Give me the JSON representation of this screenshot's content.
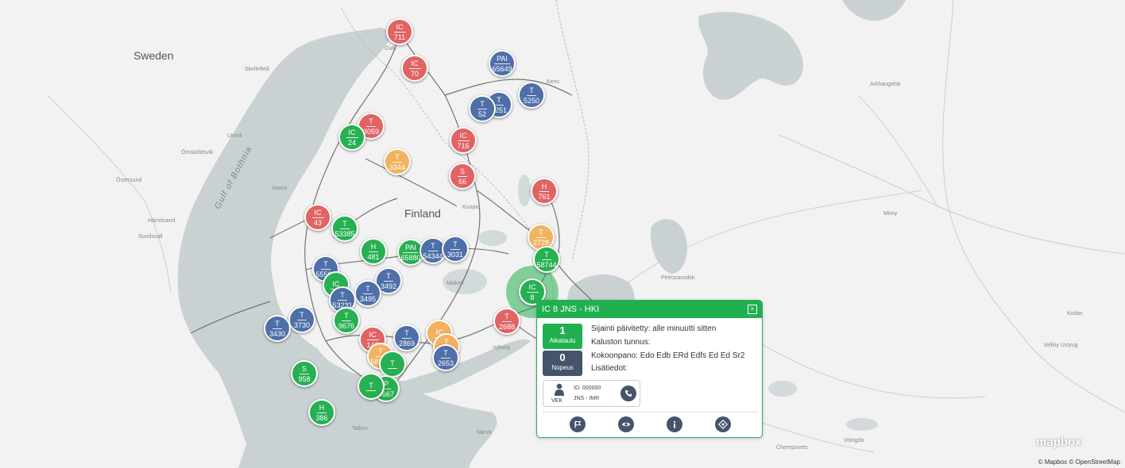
{
  "map": {
    "countries": [
      "Sweden",
      "Finland"
    ],
    "seas": [
      "Gulf of Bothnia"
    ],
    "cities": [
      "Oulu",
      "Skellefteå",
      "Umeå",
      "Örnsköldsvik",
      "Östersund",
      "Vaasa",
      "Härnösand",
      "Sundsvall",
      "Kuopio",
      "Mikkeli",
      "Vyborg",
      "Tallinn",
      "Narva",
      "Petrozavodsk",
      "Arkhangelsk",
      "Mirny",
      "Kotlas",
      "Velikiy Ustyug",
      "Vologda",
      "Cherepovets",
      "Kemi"
    ],
    "attribution": "© Mapbox © OpenStreetMap",
    "logo": "mapbox"
  },
  "colors": {
    "red": "#e16363",
    "green": "#27b052",
    "blue": "#4e6fa8",
    "orange": "#f3b260",
    "accent": "#20b04f",
    "button": "#45546a"
  },
  "markers": [
    {
      "type": "IC",
      "num": "711",
      "color": "red"
    },
    {
      "type": "IC",
      "num": "70",
      "color": "red"
    },
    {
      "type": "PAI",
      "num": "65649",
      "color": "blue"
    },
    {
      "type": "T",
      "num": "5250",
      "color": "blue"
    },
    {
      "type": "T",
      "num": "5251",
      "color": "blue"
    },
    {
      "type": "T",
      "num": "52",
      "color": "blue"
    },
    {
      "type": "T",
      "num": "3059",
      "color": "red"
    },
    {
      "type": "IC",
      "num": "24",
      "color": "green"
    },
    {
      "type": "IC",
      "num": "716",
      "color": "red"
    },
    {
      "type": "T",
      "num": "3344",
      "color": "orange"
    },
    {
      "type": "S",
      "num": "66",
      "color": "red"
    },
    {
      "type": "H",
      "num": "761",
      "color": "red"
    },
    {
      "type": "IC",
      "num": "43",
      "color": "red"
    },
    {
      "type": "T",
      "num": "53385",
      "color": "green"
    },
    {
      "type": "T",
      "num": "2728",
      "color": "orange"
    },
    {
      "type": "T",
      "num": "58744",
      "color": "green"
    },
    {
      "type": "H",
      "num": "481",
      "color": "green"
    },
    {
      "type": "PAI",
      "num": "65880",
      "color": "green"
    },
    {
      "type": "T",
      "num": "54344",
      "color": "blue"
    },
    {
      "type": "T",
      "num": "3031",
      "color": "blue"
    },
    {
      "type": "T",
      "num": "55502",
      "color": "blue"
    },
    {
      "type": "T",
      "num": "3492",
      "color": "blue"
    },
    {
      "type": "IC",
      "num": "",
      "color": "green"
    },
    {
      "type": "T",
      "num": "3495",
      "color": "blue"
    },
    {
      "type": "T",
      "num": "53231",
      "color": "blue"
    },
    {
      "type": "T",
      "num": "9676",
      "color": "green"
    },
    {
      "type": "T",
      "num": "3730",
      "color": "blue"
    },
    {
      "type": "T",
      "num": "3430",
      "color": "blue"
    },
    {
      "type": "T",
      "num": "2688",
      "color": "red"
    },
    {
      "type": "IC",
      "num": "142",
      "color": "red"
    },
    {
      "type": "T",
      "num": "2869",
      "color": "blue"
    },
    {
      "type": "IC",
      "num": "",
      "color": "orange"
    },
    {
      "type": "T",
      "num": "52455",
      "color": "orange"
    },
    {
      "type": "T",
      "num": "2653",
      "color": "blue"
    },
    {
      "type": "T",
      "num": "58850",
      "color": "orange"
    },
    {
      "type": "T",
      "num": "",
      "color": "green"
    },
    {
      "type": "S",
      "num": "958",
      "color": "green"
    },
    {
      "type": "P",
      "num": "8667",
      "color": "green"
    },
    {
      "type": "T",
      "num": "",
      "color": "green"
    },
    {
      "type": "H",
      "num": "386",
      "color": "green"
    }
  ],
  "selected": {
    "type": "IC",
    "num": "8"
  },
  "popup": {
    "title": "IC 8 JNS - HKI",
    "close_icon": "close-icon",
    "schedule": {
      "value": "1",
      "label": "Aikataulu"
    },
    "speed": {
      "value": "0",
      "label": "Nopeus"
    },
    "lines": [
      "Sijainti päivitetty: alle minuutti sitten",
      "Kaluston tunnus:",
      "Kokoonpano: Edo Edb ERd Edfs Ed Ed Sr2",
      "Lisätiedot:"
    ],
    "crew": {
      "role": "VEK",
      "id": "ID: 000000",
      "route": "JNS - IMR",
      "icon": "person-icon",
      "call_icon": "phone-icon"
    },
    "actions": [
      "flag-icon",
      "eye-icon",
      "info-icon",
      "locate-icon"
    ]
  }
}
